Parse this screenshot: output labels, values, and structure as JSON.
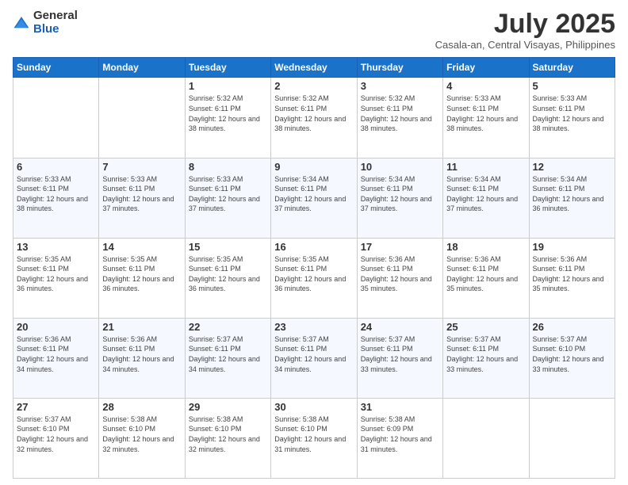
{
  "header": {
    "logo_general": "General",
    "logo_blue": "Blue",
    "title": "July 2025",
    "subtitle": "Casala-an, Central Visayas, Philippines"
  },
  "days_of_week": [
    "Sunday",
    "Monday",
    "Tuesday",
    "Wednesday",
    "Thursday",
    "Friday",
    "Saturday"
  ],
  "weeks": [
    [
      {
        "day": "",
        "sunrise": "",
        "sunset": "",
        "daylight": ""
      },
      {
        "day": "",
        "sunrise": "",
        "sunset": "",
        "daylight": ""
      },
      {
        "day": "1",
        "sunrise": "Sunrise: 5:32 AM",
        "sunset": "Sunset: 6:11 PM",
        "daylight": "Daylight: 12 hours and 38 minutes."
      },
      {
        "day": "2",
        "sunrise": "Sunrise: 5:32 AM",
        "sunset": "Sunset: 6:11 PM",
        "daylight": "Daylight: 12 hours and 38 minutes."
      },
      {
        "day": "3",
        "sunrise": "Sunrise: 5:32 AM",
        "sunset": "Sunset: 6:11 PM",
        "daylight": "Daylight: 12 hours and 38 minutes."
      },
      {
        "day": "4",
        "sunrise": "Sunrise: 5:33 AM",
        "sunset": "Sunset: 6:11 PM",
        "daylight": "Daylight: 12 hours and 38 minutes."
      },
      {
        "day": "5",
        "sunrise": "Sunrise: 5:33 AM",
        "sunset": "Sunset: 6:11 PM",
        "daylight": "Daylight: 12 hours and 38 minutes."
      }
    ],
    [
      {
        "day": "6",
        "sunrise": "Sunrise: 5:33 AM",
        "sunset": "Sunset: 6:11 PM",
        "daylight": "Daylight: 12 hours and 38 minutes."
      },
      {
        "day": "7",
        "sunrise": "Sunrise: 5:33 AM",
        "sunset": "Sunset: 6:11 PM",
        "daylight": "Daylight: 12 hours and 37 minutes."
      },
      {
        "day": "8",
        "sunrise": "Sunrise: 5:33 AM",
        "sunset": "Sunset: 6:11 PM",
        "daylight": "Daylight: 12 hours and 37 minutes."
      },
      {
        "day": "9",
        "sunrise": "Sunrise: 5:34 AM",
        "sunset": "Sunset: 6:11 PM",
        "daylight": "Daylight: 12 hours and 37 minutes."
      },
      {
        "day": "10",
        "sunrise": "Sunrise: 5:34 AM",
        "sunset": "Sunset: 6:11 PM",
        "daylight": "Daylight: 12 hours and 37 minutes."
      },
      {
        "day": "11",
        "sunrise": "Sunrise: 5:34 AM",
        "sunset": "Sunset: 6:11 PM",
        "daylight": "Daylight: 12 hours and 37 minutes."
      },
      {
        "day": "12",
        "sunrise": "Sunrise: 5:34 AM",
        "sunset": "Sunset: 6:11 PM",
        "daylight": "Daylight: 12 hours and 36 minutes."
      }
    ],
    [
      {
        "day": "13",
        "sunrise": "Sunrise: 5:35 AM",
        "sunset": "Sunset: 6:11 PM",
        "daylight": "Daylight: 12 hours and 36 minutes."
      },
      {
        "day": "14",
        "sunrise": "Sunrise: 5:35 AM",
        "sunset": "Sunset: 6:11 PM",
        "daylight": "Daylight: 12 hours and 36 minutes."
      },
      {
        "day": "15",
        "sunrise": "Sunrise: 5:35 AM",
        "sunset": "Sunset: 6:11 PM",
        "daylight": "Daylight: 12 hours and 36 minutes."
      },
      {
        "day": "16",
        "sunrise": "Sunrise: 5:35 AM",
        "sunset": "Sunset: 6:11 PM",
        "daylight": "Daylight: 12 hours and 36 minutes."
      },
      {
        "day": "17",
        "sunrise": "Sunrise: 5:36 AM",
        "sunset": "Sunset: 6:11 PM",
        "daylight": "Daylight: 12 hours and 35 minutes."
      },
      {
        "day": "18",
        "sunrise": "Sunrise: 5:36 AM",
        "sunset": "Sunset: 6:11 PM",
        "daylight": "Daylight: 12 hours and 35 minutes."
      },
      {
        "day": "19",
        "sunrise": "Sunrise: 5:36 AM",
        "sunset": "Sunset: 6:11 PM",
        "daylight": "Daylight: 12 hours and 35 minutes."
      }
    ],
    [
      {
        "day": "20",
        "sunrise": "Sunrise: 5:36 AM",
        "sunset": "Sunset: 6:11 PM",
        "daylight": "Daylight: 12 hours and 34 minutes."
      },
      {
        "day": "21",
        "sunrise": "Sunrise: 5:36 AM",
        "sunset": "Sunset: 6:11 PM",
        "daylight": "Daylight: 12 hours and 34 minutes."
      },
      {
        "day": "22",
        "sunrise": "Sunrise: 5:37 AM",
        "sunset": "Sunset: 6:11 PM",
        "daylight": "Daylight: 12 hours and 34 minutes."
      },
      {
        "day": "23",
        "sunrise": "Sunrise: 5:37 AM",
        "sunset": "Sunset: 6:11 PM",
        "daylight": "Daylight: 12 hours and 34 minutes."
      },
      {
        "day": "24",
        "sunrise": "Sunrise: 5:37 AM",
        "sunset": "Sunset: 6:11 PM",
        "daylight": "Daylight: 12 hours and 33 minutes."
      },
      {
        "day": "25",
        "sunrise": "Sunrise: 5:37 AM",
        "sunset": "Sunset: 6:11 PM",
        "daylight": "Daylight: 12 hours and 33 minutes."
      },
      {
        "day": "26",
        "sunrise": "Sunrise: 5:37 AM",
        "sunset": "Sunset: 6:10 PM",
        "daylight": "Daylight: 12 hours and 33 minutes."
      }
    ],
    [
      {
        "day": "27",
        "sunrise": "Sunrise: 5:37 AM",
        "sunset": "Sunset: 6:10 PM",
        "daylight": "Daylight: 12 hours and 32 minutes."
      },
      {
        "day": "28",
        "sunrise": "Sunrise: 5:38 AM",
        "sunset": "Sunset: 6:10 PM",
        "daylight": "Daylight: 12 hours and 32 minutes."
      },
      {
        "day": "29",
        "sunrise": "Sunrise: 5:38 AM",
        "sunset": "Sunset: 6:10 PM",
        "daylight": "Daylight: 12 hours and 32 minutes."
      },
      {
        "day": "30",
        "sunrise": "Sunrise: 5:38 AM",
        "sunset": "Sunset: 6:10 PM",
        "daylight": "Daylight: 12 hours and 31 minutes."
      },
      {
        "day": "31",
        "sunrise": "Sunrise: 5:38 AM",
        "sunset": "Sunset: 6:09 PM",
        "daylight": "Daylight: 12 hours and 31 minutes."
      },
      {
        "day": "",
        "sunrise": "",
        "sunset": "",
        "daylight": ""
      },
      {
        "day": "",
        "sunrise": "",
        "sunset": "",
        "daylight": ""
      }
    ]
  ]
}
